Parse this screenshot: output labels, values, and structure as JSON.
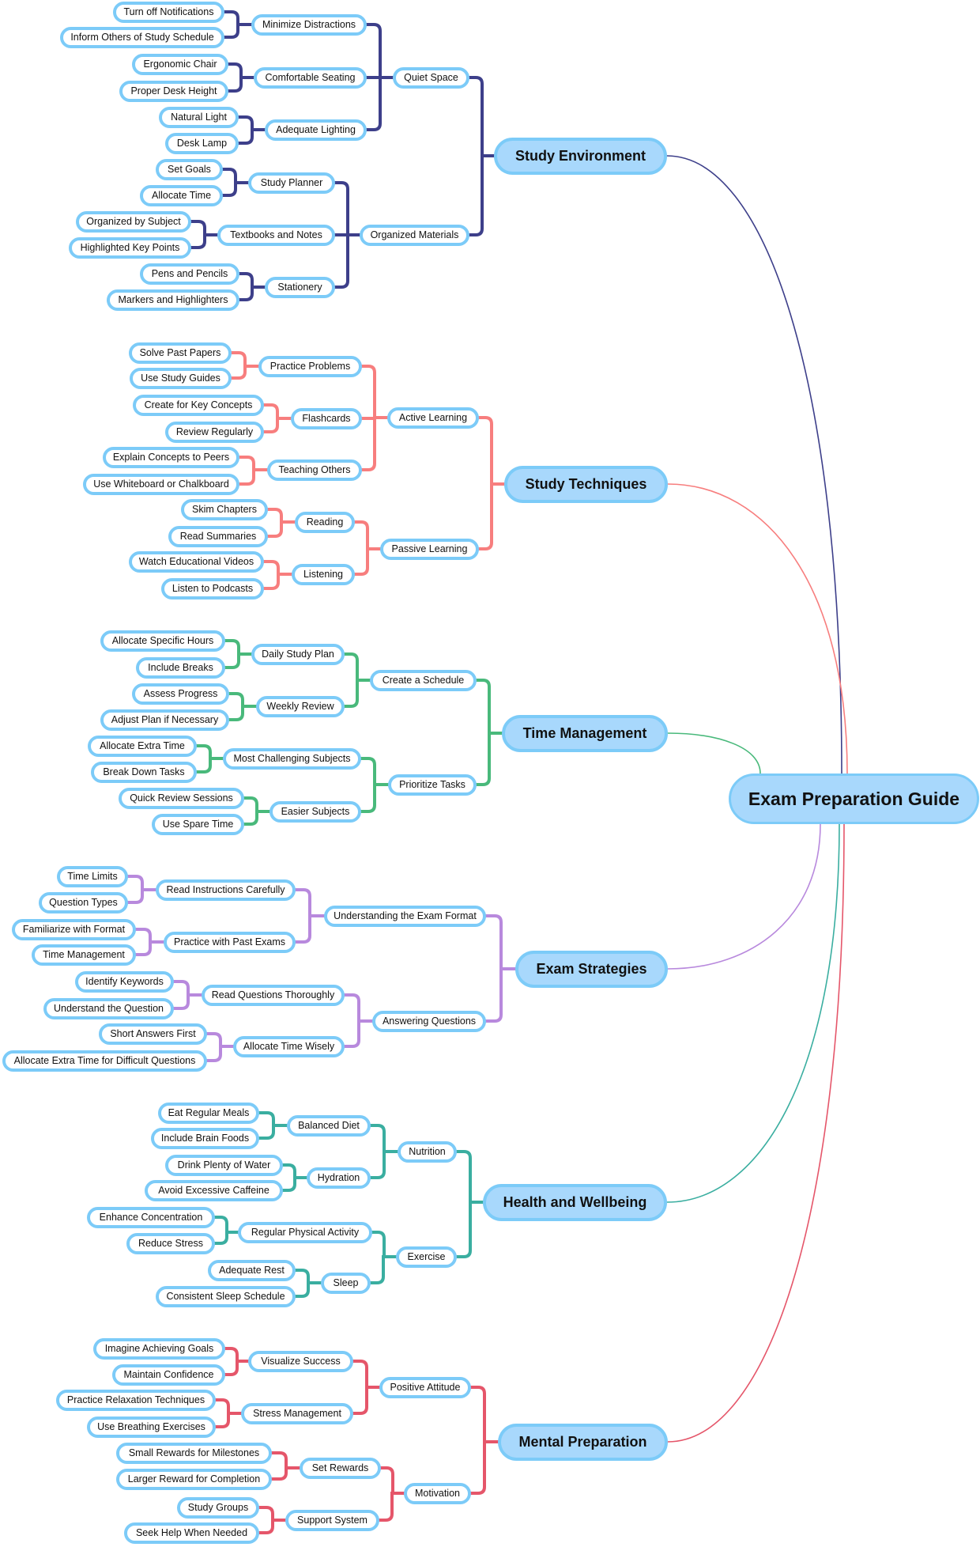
{
  "title": "Exam Preparation Guide",
  "branches": [
    {
      "label": "Study Environment",
      "color": "#3d3f8a",
      "children": [
        {
          "label": "Quiet Space",
          "children": [
            {
              "label": "Minimize Distractions",
              "children": [
                {
                  "label": "Turn off Notifications"
                },
                {
                  "label": "Inform Others of Study Schedule"
                }
              ]
            },
            {
              "label": "Comfortable Seating",
              "children": [
                {
                  "label": "Ergonomic Chair"
                },
                {
                  "label": "Proper Desk Height"
                }
              ]
            },
            {
              "label": "Adequate Lighting",
              "children": [
                {
                  "label": "Natural Light"
                },
                {
                  "label": "Desk Lamp"
                }
              ]
            }
          ]
        },
        {
          "label": "Organized Materials",
          "children": [
            {
              "label": "Study Planner",
              "children": [
                {
                  "label": "Set Goals"
                },
                {
                  "label": "Allocate Time"
                }
              ]
            },
            {
              "label": "Textbooks and Notes",
              "children": [
                {
                  "label": "Organized by Subject"
                },
                {
                  "label": "Highlighted Key Points"
                }
              ]
            },
            {
              "label": "Stationery",
              "children": [
                {
                  "label": "Pens and Pencils"
                },
                {
                  "label": "Markers and Highlighters"
                }
              ]
            }
          ]
        }
      ]
    },
    {
      "label": "Study Techniques",
      "color": "#f77e7e",
      "children": [
        {
          "label": "Active Learning",
          "children": [
            {
              "label": "Practice Problems",
              "children": [
                {
                  "label": "Solve Past Papers"
                },
                {
                  "label": "Use Study Guides"
                }
              ]
            },
            {
              "label": "Flashcards",
              "children": [
                {
                  "label": "Create for Key Concepts"
                },
                {
                  "label": "Review Regularly"
                }
              ]
            },
            {
              "label": "Teaching Others",
              "children": [
                {
                  "label": "Explain Concepts to Peers"
                },
                {
                  "label": "Use Whiteboard or Chalkboard"
                }
              ]
            }
          ]
        },
        {
          "label": "Passive Learning",
          "children": [
            {
              "label": "Reading",
              "children": [
                {
                  "label": "Skim Chapters"
                },
                {
                  "label": "Read Summaries"
                }
              ]
            },
            {
              "label": "Listening",
              "children": [
                {
                  "label": "Watch Educational Videos"
                },
                {
                  "label": "Listen to Podcasts"
                }
              ]
            }
          ]
        }
      ]
    },
    {
      "label": "Time Management",
      "color": "#49b97b",
      "children": [
        {
          "label": "Create a Schedule",
          "children": [
            {
              "label": "Daily Study Plan",
              "children": [
                {
                  "label": "Allocate Specific Hours"
                },
                {
                  "label": "Include Breaks"
                }
              ]
            },
            {
              "label": "Weekly Review",
              "children": [
                {
                  "label": "Assess Progress"
                },
                {
                  "label": "Adjust Plan if Necessary"
                }
              ]
            }
          ]
        },
        {
          "label": "Prioritize Tasks",
          "children": [
            {
              "label": "Most Challenging Subjects",
              "children": [
                {
                  "label": "Allocate Extra Time"
                },
                {
                  "label": "Break Down Tasks"
                }
              ]
            },
            {
              "label": "Easier Subjects",
              "children": [
                {
                  "label": "Quick Review Sessions"
                },
                {
                  "label": "Use Spare Time"
                }
              ]
            }
          ]
        }
      ]
    },
    {
      "label": "Exam Strategies",
      "color": "#b889dd",
      "children": [
        {
          "label": "Understanding the Exam Format",
          "children": [
            {
              "label": "Read Instructions Carefully",
              "children": [
                {
                  "label": "Time Limits"
                },
                {
                  "label": "Question Types"
                }
              ]
            },
            {
              "label": "Practice with Past Exams",
              "children": [
                {
                  "label": "Familiarize with Format"
                },
                {
                  "label": "Time Management"
                }
              ]
            }
          ]
        },
        {
          "label": "Answering Questions",
          "children": [
            {
              "label": "Read Questions Thoroughly",
              "children": [
                {
                  "label": "Identify Keywords"
                },
                {
                  "label": "Understand the Question"
                }
              ]
            },
            {
              "label": "Allocate Time Wisely",
              "children": [
                {
                  "label": "Short Answers First"
                },
                {
                  "label": "Allocate Extra Time for Difficult Questions"
                }
              ]
            }
          ]
        }
      ]
    },
    {
      "label": "Health and Wellbeing",
      "color": "#3aaea0",
      "children": [
        {
          "label": "Nutrition",
          "children": [
            {
              "label": "Balanced Diet",
              "children": [
                {
                  "label": "Eat Regular Meals"
                },
                {
                  "label": "Include Brain Foods"
                }
              ]
            },
            {
              "label": "Hydration",
              "children": [
                {
                  "label": "Drink Plenty of Water"
                },
                {
                  "label": "Avoid Excessive Caffeine"
                }
              ]
            }
          ]
        },
        {
          "label": "Exercise",
          "children": [
            {
              "label": "Regular Physical Activity",
              "children": [
                {
                  "label": "Enhance Concentration"
                },
                {
                  "label": "Reduce Stress"
                }
              ]
            },
            {
              "label": "Sleep",
              "children": [
                {
                  "label": "Adequate Rest"
                },
                {
                  "label": "Consistent Sleep Schedule"
                }
              ]
            }
          ]
        }
      ]
    },
    {
      "label": "Mental Preparation",
      "color": "#e5566a",
      "children": [
        {
          "label": "Positive Attitude",
          "children": [
            {
              "label": "Visualize Success",
              "children": [
                {
                  "label": "Imagine Achieving Goals"
                },
                {
                  "label": "Maintain Confidence"
                }
              ]
            },
            {
              "label": "Stress Management",
              "children": [
                {
                  "label": "Practice Relaxation Techniques"
                },
                {
                  "label": "Use Breathing Exercises"
                }
              ]
            }
          ]
        },
        {
          "label": "Motivation",
          "children": [
            {
              "label": "Set Rewards",
              "children": [
                {
                  "label": "Small Rewards for Milestones"
                },
                {
                  "label": "Larger Reward for Completion"
                }
              ]
            },
            {
              "label": "Support System",
              "children": [
                {
                  "label": "Study Groups"
                },
                {
                  "label": "Seek Help When Needed"
                }
              ]
            }
          ]
        }
      ]
    }
  ]
}
